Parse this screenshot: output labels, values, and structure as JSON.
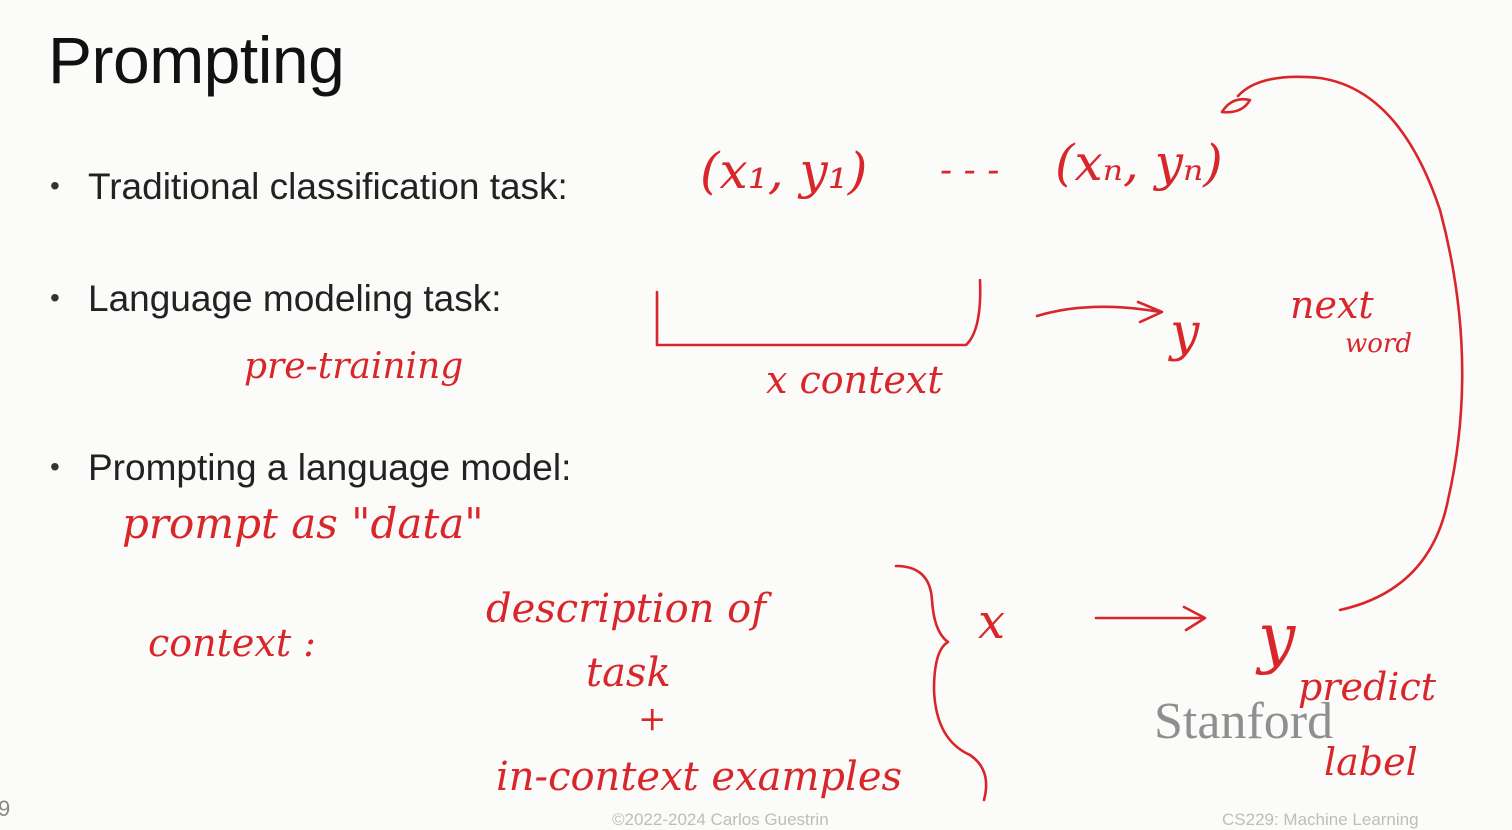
{
  "slide": {
    "title": "Prompting",
    "bullets": [
      "Traditional classification task:",
      "Language modeling task:",
      "Prompting a language model:"
    ],
    "logo": "Stanford",
    "slide_number": "9",
    "footer_left": "©2022-2024 Carlos Guestrin",
    "footer_right": "CS229: Machine Learning"
  },
  "annotations": {
    "pairs_first": "(x₁, y₁)",
    "pairs_dots": "- - -",
    "pairs_last": "(xₙ, yₙ)",
    "pretraining": "pre-training",
    "x_context": "x context",
    "y1": "y",
    "next": "next",
    "word": "word",
    "prompt_data": "prompt as \"data\"",
    "context_label": "context :",
    "description": "description of",
    "task": "task",
    "plus": "+",
    "examples": "in-context examples",
    "x2": "x",
    "y2": "y",
    "predict": "predict",
    "label": "label",
    "ink_color": "#d8262b"
  }
}
